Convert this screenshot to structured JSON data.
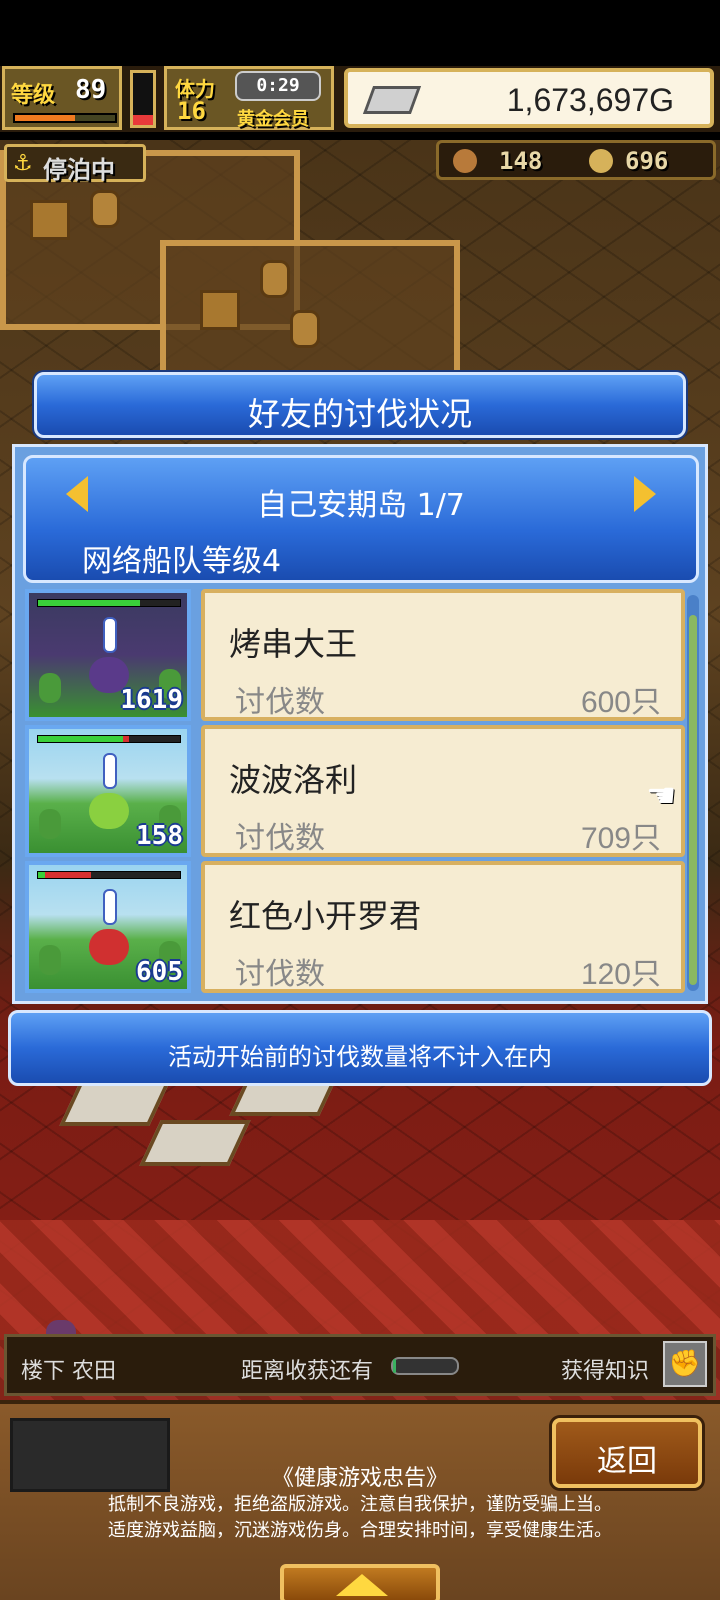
{
  "hud": {
    "level_label": "等级",
    "level_value": "89",
    "stamina_label": "体力",
    "stamina_value": "16",
    "timer": "0:29",
    "vip_label": "黄金会员",
    "money": "1,673,697G",
    "anchor_status": "停泊中",
    "resource_1": "148",
    "resource_2": "696",
    "xp_fraction": 0.6,
    "stamina_fraction": 0.2
  },
  "dialog": {
    "title": "好友的讨伐状况",
    "island": "自己安期岛 1/7",
    "fleet_level": "网络船队等级4",
    "entries": [
      {
        "name": "烤串大王",
        "label": "讨伐数",
        "count": "600只",
        "thumb_count": "1619",
        "hp_fraction": 0.72,
        "hp_lost_fraction": 0.0,
        "monster_color": "#5a3a8a",
        "dark": true
      },
      {
        "name": "波波洛利",
        "label": "讨伐数",
        "count": "709只",
        "thumb_count": "158",
        "hp_fraction": 0.6,
        "hp_lost_fraction": 0.04,
        "monster_color": "#8ad040",
        "dark": false
      },
      {
        "name": "红色小开罗君",
        "label": "讨伐数",
        "count": "120只",
        "thumb_count": "605",
        "hp_fraction": 0.05,
        "hp_lost_fraction": 0.32,
        "monster_color": "#d03030",
        "dark": false
      }
    ],
    "notice": "活动开始前的讨伐数量将不计入在内"
  },
  "info": {
    "floor": "楼下 农田",
    "harvest_label": "距离收获还有",
    "harvest_fraction": 0.05,
    "knowledge_label": "获得知识"
  },
  "footer": {
    "back": "返回",
    "health_title": "《健康游戏忠告》",
    "health_line_1": "抵制不良游戏，拒绝盗版游戏。注意自我保护，谨防受骗上当。",
    "health_line_2": "适度游戏益脑，沉迷游戏伤身。合理安排时间，享受健康生活。"
  },
  "colors": {
    "accent_blue": "#2a6ad8",
    "gold": "#ffd840",
    "card_bg": "#f6ecd2"
  },
  "icons": [
    "anchor-icon",
    "meat-icon",
    "coin-icon",
    "silver-bar-icon",
    "hand-pointer-icon",
    "fist-icon",
    "arrow-left-icon",
    "arrow-right-icon",
    "arrow-up-icon"
  ]
}
